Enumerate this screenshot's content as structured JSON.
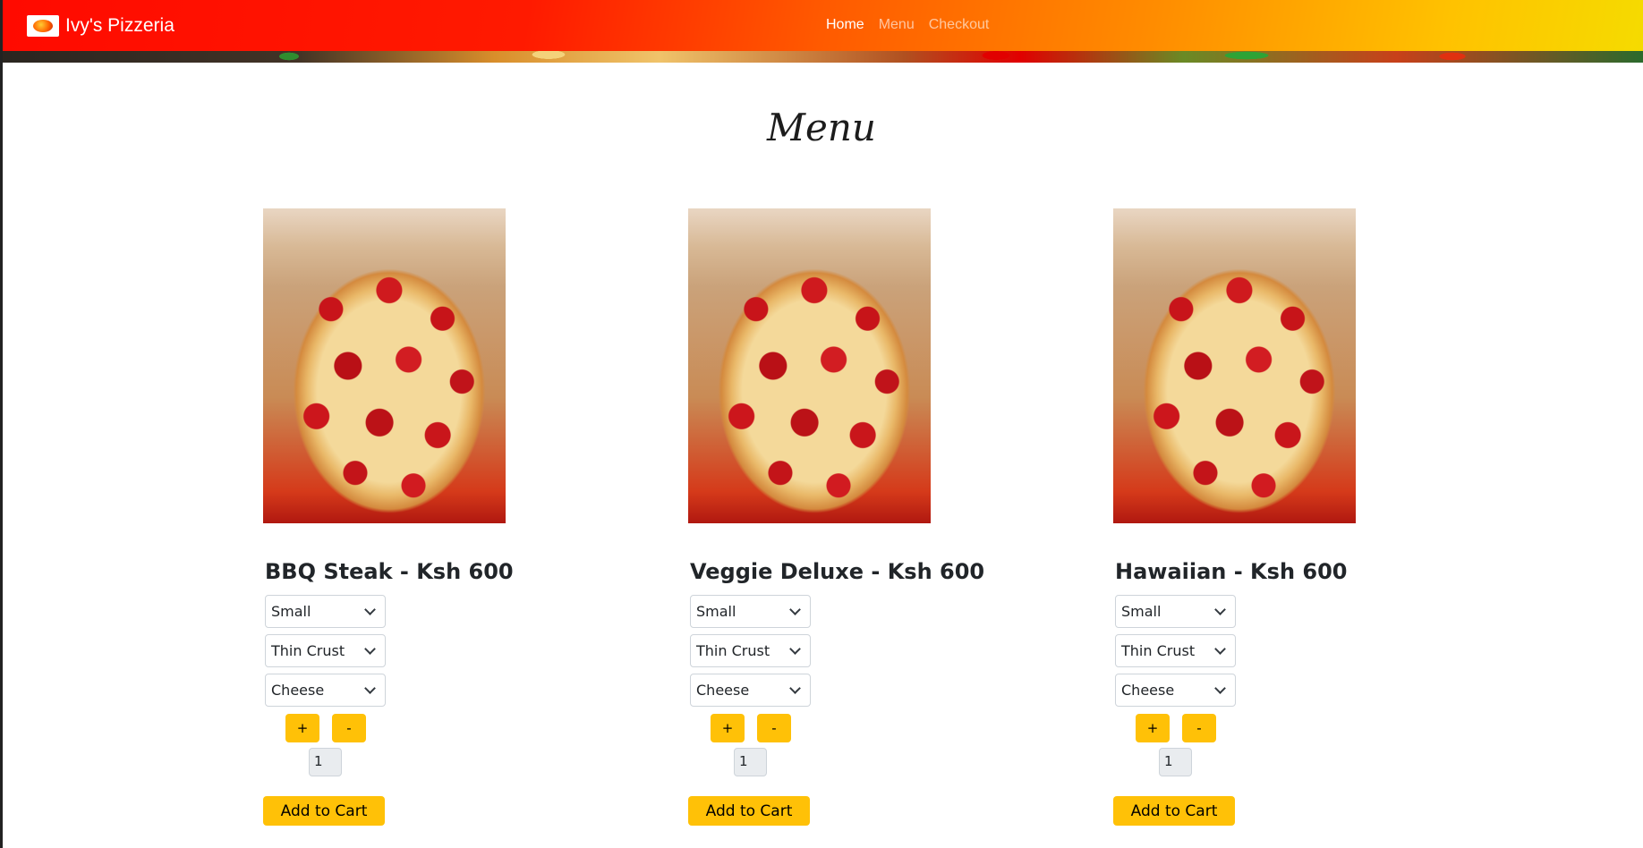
{
  "nav": {
    "brand": "Ivy's Pizzeria",
    "links": [
      "Home",
      "Menu",
      "Checkout"
    ],
    "active": "Home"
  },
  "page": {
    "title": "Menu"
  },
  "products": [
    {
      "title": "BBQ Steak - Ksh 600",
      "size": "Small",
      "crust": "Thin Crust",
      "topping": "Cheese",
      "increment_label": "+",
      "decrement_label": "-",
      "quantity": "1",
      "add_label": "Add to Cart"
    },
    {
      "title": "Veggie Deluxe - Ksh 600",
      "size": "Small",
      "crust": "Thin Crust",
      "topping": "Cheese",
      "increment_label": "+",
      "decrement_label": "-",
      "quantity": "1",
      "add_label": "Add to Cart"
    },
    {
      "title": "Hawaiian - Ksh 600",
      "size": "Small",
      "crust": "Thin Crust",
      "topping": "Cheese",
      "increment_label": "+",
      "decrement_label": "-",
      "quantity": "1",
      "add_label": "Add to Cart"
    }
  ],
  "icons": {
    "logo": "pizza-logo-icon",
    "select": "chevron-down-icon"
  },
  "colors": {
    "accent": "#ffc107",
    "nav_start": "#ff0a00",
    "nav_end": "#f5db00"
  }
}
